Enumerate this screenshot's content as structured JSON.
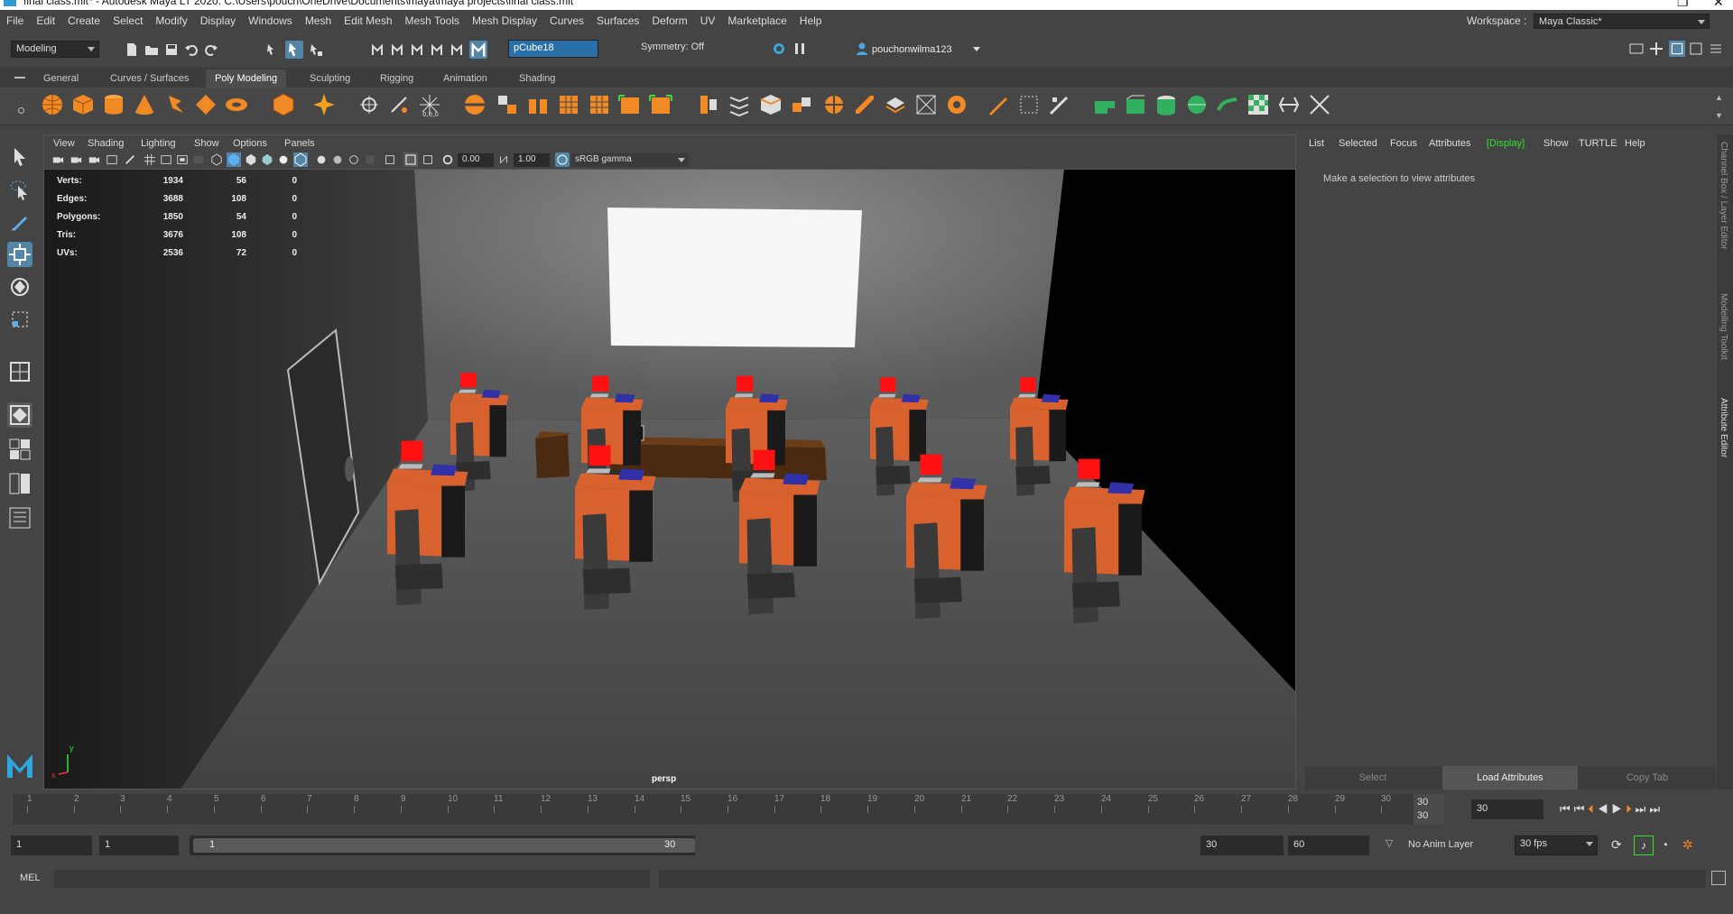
{
  "title_bar": {
    "title": "final class.mlt* - Autodesk Maya LT 2020: C:\\Users\\pouch\\OneDrive\\Documents\\maya\\maya projects\\final class.mlt"
  },
  "menu": [
    "File",
    "Edit",
    "Create",
    "Select",
    "Modify",
    "Display",
    "Windows",
    "Mesh",
    "Edit Mesh",
    "Mesh Tools",
    "Mesh Display",
    "Curves",
    "Surfaces",
    "Deform",
    "UV",
    "Marketplace",
    "Help"
  ],
  "workspace": {
    "label": "Workspace :",
    "value": "Maya Classic*"
  },
  "status_line": {
    "mode": "Modeling",
    "object_name": "pCube18",
    "symmetry": "Symmetry: Off",
    "user": "pouchonwilma123"
  },
  "shelf_tabs": [
    "General",
    "Curves / Surfaces",
    "Poly Modeling",
    "Sculpting",
    "Rigging",
    "Animation",
    "Shading"
  ],
  "active_shelf_tab": "Poly Modeling",
  "viewport": {
    "menu": [
      "View",
      "Shading",
      "Lighting",
      "Show",
      "Options",
      "Panels"
    ],
    "exposure": "0.00",
    "gamma": "1.00",
    "color_space": "sRGB gamma",
    "camera": "persp",
    "hud": [
      {
        "label": "Verts:",
        "a": "1934",
        "b": "56",
        "c": "0"
      },
      {
        "label": "Edges:",
        "a": "3688",
        "b": "108",
        "c": "0"
      },
      {
        "label": "Polygons:",
        "a": "1850",
        "b": "54",
        "c": "0"
      },
      {
        "label": "Tris:",
        "a": "3676",
        "b": "108",
        "c": "0"
      },
      {
        "label": "UVs:",
        "a": "2536",
        "b": "72",
        "c": "0"
      }
    ],
    "axis_y": "y",
    "axis_x": "x"
  },
  "attribute_editor": {
    "menu": [
      "List",
      "Selected",
      "Focus",
      "Attributes",
      "[Display]",
      "Show",
      "TURTLE",
      "Help"
    ],
    "message": "Make a selection to view attributes",
    "buttons": [
      "Select",
      "Load Attributes",
      "Copy Tab"
    ]
  },
  "side_tabs": [
    "Channel Box / Layer Editor",
    "Modelling Toolkit",
    "Attribute Editor"
  ],
  "timeline": {
    "ticks": [
      "1",
      "2",
      "3",
      "4",
      "5",
      "6",
      "7",
      "8",
      "9",
      "10",
      "11",
      "12",
      "13",
      "14",
      "15",
      "16",
      "17",
      "18",
      "19",
      "20",
      "21",
      "22",
      "23",
      "24",
      "25",
      "26",
      "27",
      "28",
      "29",
      "30"
    ],
    "current_frame_top": "30",
    "current_frame_bottom": "30",
    "current_field": "30"
  },
  "range": {
    "start": "1",
    "playback_start": "1",
    "slider_start": "1",
    "slider_end": "30",
    "playback_end": "30",
    "end": "60",
    "anim_layer": "No Anim Layer",
    "fps": "30 fps"
  },
  "command_line": {
    "label": "MEL"
  },
  "colors": {
    "accent": "#5285a6",
    "display_green": "#32e032",
    "desk": "#d8612e",
    "chair": "#3a3a3a",
    "book": "#3030a8",
    "box": "#ff1111"
  }
}
